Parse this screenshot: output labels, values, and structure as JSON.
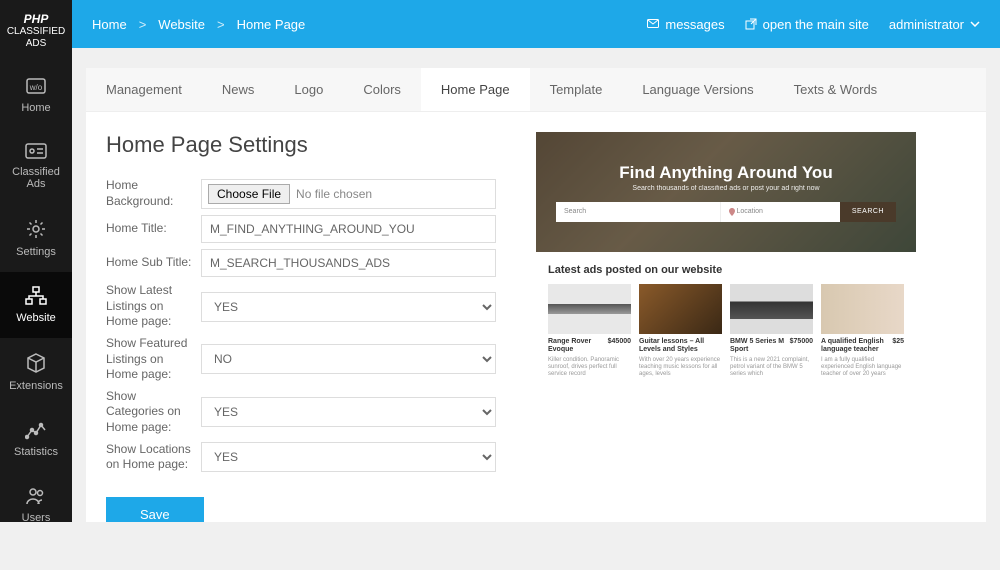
{
  "logo": {
    "line1": "PHP",
    "line2": "CLASSIFIED",
    "line3": "ADS"
  },
  "sidebar": [
    {
      "label": "Home"
    },
    {
      "label": "Classified Ads"
    },
    {
      "label": "Settings"
    },
    {
      "label": "Website"
    },
    {
      "label": "Extensions"
    },
    {
      "label": "Statistics"
    },
    {
      "label": "Users"
    }
  ],
  "breadcrumb": [
    "Home",
    "Website",
    "Home Page"
  ],
  "topbar": {
    "messages": "messages",
    "open_site": "open the main site",
    "user": "administrator"
  },
  "tabs": [
    "Management",
    "News",
    "Logo",
    "Colors",
    "Home Page",
    "Template",
    "Language Versions",
    "Texts & Words"
  ],
  "heading": "Home Page Settings",
  "form": {
    "bg_label": "Home Background:",
    "title_label": "Home Title:",
    "sub_label": "Home Sub Title:",
    "latest_label": "Show Latest Listings on Home page:",
    "featured_label": "Show Featured Listings on Home page:",
    "cat_label": "Show Categories on Home page:",
    "loc_label": "Show Locations on Home page:",
    "file_btn": "Choose File",
    "file_none": "No file chosen",
    "title_val": "M_FIND_ANYTHING_AROUND_YOU",
    "sub_val": "M_SEARCH_THOUSANDS_ADS",
    "latest_val": "YES",
    "featured_val": "NO",
    "cat_val": "YES",
    "loc_val": "YES",
    "save": "Save"
  },
  "preview": {
    "hero_title": "Find Anything Around You",
    "hero_sub": "Search thousands of classified ads or post your ad right now",
    "search_ph": "Search",
    "loc_ph": "Location",
    "search_btn": "SEARCH",
    "list_h": "Latest ads posted on our website",
    "cards": [
      {
        "title": "Range Rover Evoque",
        "price": "$45000"
      },
      {
        "title": "Guitar lessons – All Levels and Styles",
        "price": ""
      },
      {
        "title": "BMW 5 Series M Sport",
        "price": "$75000"
      },
      {
        "title": "A qualified English language teacher",
        "price": "$25"
      }
    ]
  }
}
